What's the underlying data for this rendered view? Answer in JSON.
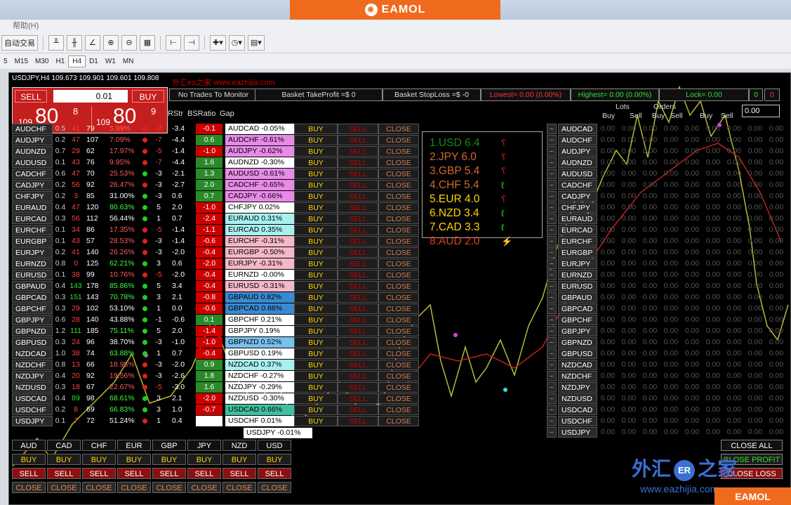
{
  "brand": "EAMOL",
  "menu": "帮助(H)",
  "toolbar": {
    "autotrade": "自动交易"
  },
  "timeframes": [
    "5",
    "M15",
    "M30",
    "H1",
    "H4",
    "D1",
    "W1",
    "MN"
  ],
  "window_title": "USDJPY,H4  109.673 109.901 109.601 109.808",
  "watermark": "外汇ea之家 www.eazhijia.com",
  "trade": {
    "sell": "SELL",
    "buy": "BUY",
    "lots": "0.01",
    "bid_small": "109",
    "bid_big": "80",
    "bid_sup": "8",
    "ask_small": "109",
    "ask_big": "80",
    "ask_sup": "9"
  },
  "headers": {
    "monitor": "No Trades To Monitor",
    "tp": "Basket TakeProfit =$ 0",
    "sl": "Basket StopLoss =$ -0",
    "lowest": "Lowest= 0.00 (0.00%)",
    "highest": "Highest= 0.00 (0.00%)",
    "lock": "Lock= 0.00",
    "c0": "0",
    "c1": "0"
  },
  "cols": {
    "rstr": "RStr",
    "bsratio": "BSRatio",
    "gap": "Gap",
    "lots": "Lots",
    "orders": "Orders",
    "buy": "Buy",
    "sell": "Sell",
    "total": "0.00"
  },
  "buttons": {
    "buy": "BUY",
    "sell": "SELL",
    "close": "CLOSE"
  },
  "pairs": [
    {
      "s": "AUDCHF",
      "a": "0.5",
      "b": "41",
      "c": "79",
      "p": "5.99%",
      "pc": "#ff5a5a",
      "d": "#e02020",
      "r": "-7",
      "rc": "#ff4040",
      "bs": "-3.4",
      "g": "-0.1",
      "gc": "#c00",
      "pl": "AUDCAD -0.05%",
      "bg": "#ffffff"
    },
    {
      "s": "AUDJPY",
      "a": "0.2",
      "b": "47",
      "c": "107",
      "p": "7.09%",
      "pc": "#ff5a5a",
      "d": "#e02020",
      "r": "-7",
      "rc": "#ff4040",
      "bs": "-4.4",
      "g": "0.6",
      "gc": "#2a8a2a",
      "pl": "AUDCHF -0.61%",
      "bg": "#e88ae8"
    },
    {
      "s": "AUDNZD",
      "a": "0.7",
      "b": "29",
      "c": "62",
      "p": "17.97%",
      "pc": "#ff5a5a",
      "d": "#e02020",
      "r": "-5",
      "rc": "#ff4040",
      "bs": "-1.4",
      "g": "-1.0",
      "gc": "#c00",
      "pl": "AUDJPY -0.62%",
      "bg": "#e88ae8"
    },
    {
      "s": "AUDUSD",
      "a": "0.1",
      "b": "43",
      "c": "76",
      "p": "9.95%",
      "pc": "#ff5a5a",
      "d": "#e02020",
      "r": "-7",
      "rc": "#ff4040",
      "bs": "-4.4",
      "g": "1.6",
      "gc": "#2a8a2a",
      "pl": "AUDNZD -0.30%",
      "bg": "#ffffff"
    },
    {
      "s": "CADCHF",
      "a": "0.6",
      "b": "47",
      "c": "70",
      "p": "25.53%",
      "pc": "#ff5a5a",
      "d": "#20d020",
      "r": "-3",
      "rc": "#fff",
      "bs": "-2.1",
      "g": "1.3",
      "gc": "#2a8a2a",
      "pl": "AUDUSD -0.61%",
      "bg": "#e88ae8"
    },
    {
      "s": "CADJPY",
      "a": "0.2",
      "b": "56",
      "c": "92",
      "p": "26.47%",
      "pc": "#ff5a5a",
      "d": "#e02020",
      "r": "-3",
      "rc": "#fff",
      "bs": "-2.7",
      "g": "2.0",
      "gc": "#2a8a2a",
      "pl": "CADCHF -0.65%",
      "bg": "#e88ae8"
    },
    {
      "s": "CHFJPY",
      "a": "0.2",
      "b": "3",
      "c": "85",
      "p": "31.00%",
      "pc": "#fff",
      "d": "#20d020",
      "r": "-3",
      "rc": "#fff",
      "bs": "0.6",
      "g": "0.7",
      "gc": "#2a8a2a",
      "pl": "CADJPY -0.66%",
      "bg": "#e88ae8"
    },
    {
      "s": "EURAUD",
      "a": "0.4",
      "b": "47",
      "c": "120",
      "p": "80.63%",
      "pc": "#40ff40",
      "d": "#20d020",
      "r": "5",
      "rc": "#fff",
      "bs": "2.0",
      "g": "-1.0",
      "gc": "#c00",
      "pl": "CHFJPY 0.02%",
      "bg": "#ffffff"
    },
    {
      "s": "EURCAD",
      "a": "0.3",
      "b": "56",
      "c": "112",
      "p": "56.44%",
      "pc": "#fff",
      "d": "#20d020",
      "r": "1",
      "rc": "#fff",
      "bs": "0.7",
      "g": "-2.4",
      "gc": "#c00",
      "pl": "EURAUD 0.31%",
      "bg": "#a8f0f0"
    },
    {
      "s": "EURCHF",
      "a": "0.1",
      "b": "34",
      "c": "86",
      "p": "17.35%",
      "pc": "#ff5a5a",
      "d": "#e02020",
      "r": "-5",
      "rc": "#ff4040",
      "bs": "-1.4",
      "g": "-1.1",
      "gc": "#c00",
      "pl": "EURCAD 0.35%",
      "bg": "#a8f0f0"
    },
    {
      "s": "EURGBP",
      "a": "0.1",
      "b": "43",
      "c": "57",
      "p": "28.53%",
      "pc": "#ff5a5a",
      "d": "#e02020",
      "r": "-3",
      "rc": "#fff",
      "bs": "-1.4",
      "g": "-0.6",
      "gc": "#c00",
      "pl": "EURCHF -0.31%",
      "bg": "#f5b8c8"
    },
    {
      "s": "EURJPY",
      "a": "0.2",
      "b": "41",
      "c": "140",
      "p": "26.26%",
      "pc": "#ff5a5a",
      "d": "#e02020",
      "r": "-3",
      "rc": "#fff",
      "bs": "-2.0",
      "g": "-0.4",
      "gc": "#c00",
      "pl": "EURGBP -0.50%",
      "bg": "#f5b8c8"
    },
    {
      "s": "EURNZD",
      "a": "0.8",
      "b": "0",
      "c": "125",
      "p": "62.21%",
      "pc": "#40ff40",
      "d": "#20d020",
      "r": "3",
      "rc": "#fff",
      "bs": "0.6",
      "g": "-2.0",
      "gc": "#c00",
      "pl": "EURJPY -0.31%",
      "bg": "#f5b8c8"
    },
    {
      "s": "EURUSD",
      "a": "0.1",
      "b": "38",
      "c": "99",
      "p": "10.76%",
      "pc": "#ff5a5a",
      "d": "#e02020",
      "r": "-5",
      "rc": "#ff4040",
      "bs": "-2.0",
      "g": "-0.4",
      "gc": "#c00",
      "pl": "EURNZD -0.00%",
      "bg": "#ffffff"
    },
    {
      "s": "GBPAUD",
      "a": "0.4",
      "b": "143",
      "c": "178",
      "p": "85.86%",
      "pc": "#40ff40",
      "d": "#20d020",
      "r": "5",
      "rc": "#fff",
      "bs": "3.4",
      "g": "-0.4",
      "gc": "#c00",
      "pl": "EURUSD -0.31%",
      "bg": "#f5b8c8"
    },
    {
      "s": "GBPCAD",
      "a": "0.3",
      "b": "151",
      "c": "143",
      "p": "70.78%",
      "pc": "#40ff40",
      "d": "#20d020",
      "r": "3",
      "rc": "#fff",
      "bs": "2.1",
      "g": "-0.8",
      "gc": "#c00",
      "pl": "GBPAUD 0.82%",
      "bg": "#3a8ad0"
    },
    {
      "s": "GBPCHF",
      "a": "0.3",
      "b": "29",
      "c": "102",
      "p": "53.10%",
      "pc": "#fff",
      "d": "#20d020",
      "r": "1",
      "rc": "#fff",
      "bs": "0.0",
      "g": "-0.6",
      "gc": "#c00",
      "pl": "GBPCAD 0.86%",
      "bg": "#3a8ad0"
    },
    {
      "s": "GBPJPY",
      "a": "0.6",
      "b": "28",
      "c": "140",
      "p": "43.88%",
      "pc": "#fff",
      "d": "#20d020",
      "r": "-1",
      "rc": "#fff",
      "bs": "-0.6",
      "g": "0.1",
      "gc": "#2a8a2a",
      "pl": "GBPCHF 0.21%",
      "bg": "#ffffff"
    },
    {
      "s": "GBPNZD",
      "a": "1.2",
      "b": "111",
      "c": "185",
      "p": "75.11%",
      "pc": "#40ff40",
      "d": "#20d020",
      "r": "5",
      "rc": "#fff",
      "bs": "2.0",
      "g": "-1.4",
      "gc": "#c00",
      "pl": "GBPJPY 0.19%",
      "bg": "#ffffff"
    },
    {
      "s": "GBPUSD",
      "a": "0.3",
      "b": "24",
      "c": "96",
      "p": "38.70%",
      "pc": "#fff",
      "d": "#20d020",
      "r": "-3",
      "rc": "#fff",
      "bs": "-1.0",
      "g": "-1.0",
      "gc": "#c00",
      "pl": "GBPNZD 0.52%",
      "bg": "#7ac0f0"
    },
    {
      "s": "NZDCAD",
      "a": "1.0",
      "b": "38",
      "c": "74",
      "p": "63.88%",
      "pc": "#40ff40",
      "d": "#20d020",
      "r": "1",
      "rc": "#fff",
      "bs": "0.7",
      "g": "-0.4",
      "gc": "#c00",
      "pl": "GBPUSD 0.19%",
      "bg": "#ffffff"
    },
    {
      "s": "NZDCHF",
      "a": "0.8",
      "b": "13",
      "c": "66",
      "p": "18.95%",
      "pc": "#ff5a5a",
      "d": "#e02020",
      "r": "-3",
      "rc": "#fff",
      "bs": "-2.0",
      "g": "0.9",
      "gc": "#2a8a2a",
      "pl": "NZDCAD 0.37%",
      "bg": "#a8f0f0"
    },
    {
      "s": "NZDJPY",
      "a": "0.4",
      "b": "20",
      "c": "92",
      "p": "19.56%",
      "pc": "#ff5a5a",
      "d": "#e02020",
      "r": "-3",
      "rc": "#fff",
      "bs": "-2.6",
      "g": "1.8",
      "gc": "#2a8a2a",
      "pl": "NZDCHF -0.27%",
      "bg": "#ffffff"
    },
    {
      "s": "NZDUSD",
      "a": "0.3",
      "b": "18",
      "c": "67",
      "p": "22.67%",
      "pc": "#ff5a5a",
      "d": "#e02020",
      "r": "-5",
      "rc": "#ff4040",
      "bs": "-3.0",
      "g": "1.6",
      "gc": "#2a8a2a",
      "pl": "NZDJPY -0.29%",
      "bg": "#ffffff"
    },
    {
      "s": "USDCAD",
      "a": "0.4",
      "b": "89",
      "c": "98",
      "p": "68.61%",
      "pc": "#40ff40",
      "d": "#20d020",
      "r": "3",
      "rc": "#fff",
      "bs": "2.1",
      "g": "-2.0",
      "gc": "#c00",
      "pl": "NZDUSD -0.30%",
      "bg": "#ffffff"
    },
    {
      "s": "USDCHF",
      "a": "0.2",
      "b": "8",
      "c": "69",
      "p": "66.83%",
      "pc": "#40ff40",
      "d": "#20d020",
      "r": "3",
      "rc": "#fff",
      "bs": "1.0",
      "g": "-0.7",
      "gc": "#c00",
      "pl": "USDCAD 0.66%",
      "bg": "#40c0a0"
    },
    {
      "s": "USDJPY",
      "a": "0.1",
      "b": "7",
      "c": "72",
      "p": "51.24%",
      "pc": "#fff",
      "d": "#e02020",
      "r": "1",
      "rc": "#fff",
      "bs": "0.4",
      "g": "0.0",
      "gc": "#fff",
      "pl": "USDCHF 0.01%",
      "bg": "#ffffff"
    }
  ],
  "extra_pl": "USDJPY -0.01%",
  "strength": [
    {
      "t": "1.USD 6.4",
      "c": "#1a8a1a",
      "a": "⸮",
      "ac": "#e02020"
    },
    {
      "t": "2.JPY  6.0",
      "c": "#d06a30",
      "a": "⸮",
      "ac": "#e02020"
    },
    {
      "t": "3.GBP 5.4",
      "c": "#d06a30",
      "a": "⸮",
      "ac": "#e02020"
    },
    {
      "t": "4.CHF 5.4",
      "c": "#d06a30",
      "a": "ℓ",
      "ac": "#20d020"
    },
    {
      "t": "5.EUR 4.0",
      "c": "#ffd400",
      "a": "⸮",
      "ac": "#e02020"
    },
    {
      "t": "6.NZD 3.4",
      "c": "#ffd400",
      "a": "ℓ",
      "ac": "#20d020"
    },
    {
      "t": "7.CAD 3.3",
      "c": "#ffd400",
      "a": "ℓ",
      "ac": "#20d020"
    },
    {
      "t": "8.AUD 2.0",
      "c": "#e04020",
      "a": "⚡",
      "ac": "#ffd400"
    }
  ],
  "right_pairs": [
    "AUDCAD",
    "AUDCHF",
    "AUDJPY",
    "AUDNZD",
    "AUDUSD",
    "CADCHF",
    "CADJPY",
    "CHFJPY",
    "EURAUD",
    "EURCAD",
    "EURCHF",
    "EURGBP",
    "EURJPY",
    "EURNZD",
    "EURUSD",
    "GBPAUD",
    "GBPCAD",
    "GBPCHF",
    "GBPJPY",
    "GBPNZD",
    "GBPUSD",
    "NZDCAD",
    "NZDCHF",
    "NZDJPY",
    "NZDUSD",
    "USDCAD",
    "USDCHF",
    "USDJPY"
  ],
  "zero": "0.00",
  "currencies": [
    "AUD",
    "CAD",
    "CHF",
    "EUR",
    "GBP",
    "JPY",
    "NZD",
    "USD"
  ],
  "right_buttons": {
    "close_all": "CLOSE ALL",
    "close_profit": "CLOSE PROFIT",
    "close_loss": "CLOSE LOSS"
  },
  "wm_cn": "外汇",
  "wm_cn2": "之家",
  "wm_url": "www.eazhijia.com",
  "colors": {
    "brand": "#f06a1e",
    "panel": "#000000",
    "sell": "#c41e1e"
  }
}
